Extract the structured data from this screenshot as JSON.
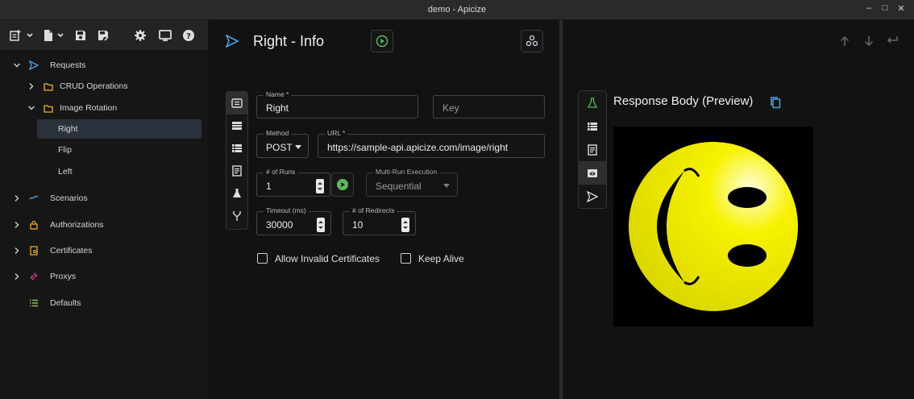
{
  "window": {
    "title": "demo - Apicize",
    "controls": [
      "minimize",
      "maximize",
      "close"
    ]
  },
  "toolbar": {
    "icons": [
      "add-request-icon",
      "add-chevron-icon",
      "open-file-icon",
      "open-chevron-icon",
      "save-icon",
      "save-as-icon",
      "settings-icon",
      "display-icon",
      "help-icon"
    ]
  },
  "nav": {
    "requests": "Requests",
    "crud": "CRUD Operations",
    "image_rotation": "Image Rotation",
    "right": "Right",
    "flip": "Flip",
    "left": "Left",
    "scenarios": "Scenarios",
    "authorizations": "Authorizations",
    "certificates": "Certificates",
    "proxys": "Proxys",
    "defaults": "Defaults"
  },
  "request": {
    "title": "Right - Info",
    "name_label": "Name *",
    "name_value": "Right",
    "key_placeholder": "Key",
    "method_label": "Method",
    "method_value": "POST",
    "url_label": "URL *",
    "url_value": "https://sample-api.apicize.com/image/right",
    "runs_label": "# of Runs",
    "runs_value": "1",
    "multirun_label": "Multi-Run Execution",
    "multirun_value": "Sequential",
    "timeout_label": "Timeout (ms)",
    "timeout_value": "30000",
    "redirects_label": "# of Redirects",
    "redirects_value": "10",
    "allow_invalid_label": "Allow Invalid Certificates",
    "keep_alive_label": "Keep Alive"
  },
  "response": {
    "title": "Response Body (Preview)"
  },
  "colors": {
    "accent_blue": "#4fa3e0",
    "green": "#5cb85c",
    "folder_yellow": "#e8b23a",
    "auth_orange": "#e8a33a",
    "proxy_pink": "#e040a0",
    "defaults_green": "#8bc34a",
    "smiley_yellow": "#f5f000"
  }
}
